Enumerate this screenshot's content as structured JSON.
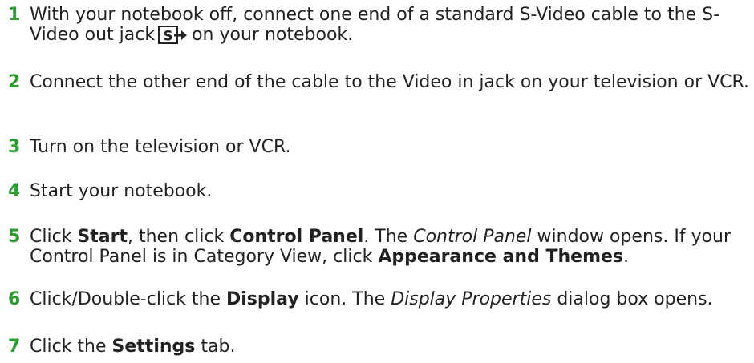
{
  "accent_color": "#2e9c33",
  "steps": [
    {
      "number": "1",
      "text_a": "With your notebook off, connect one end of a standard S-Video cable to the S-Video out jack",
      "icon": "s-video-out-icon",
      "text_b": "on your notebook."
    },
    {
      "number": "2",
      "text": "Connect the other end of the cable to the Video in jack on your television or VCR."
    },
    {
      "number": "3",
      "text": "Turn on the television or VCR."
    },
    {
      "number": "4",
      "text": "Start your notebook."
    },
    {
      "number": "5",
      "t1": "Click ",
      "b1": "Start",
      "t2": ", then click ",
      "b2": "Control Panel",
      "t3": ". The ",
      "i1": "Control Panel",
      "t4": " window opens. If your Control Panel is in Category View, click ",
      "b3": "Appearance and Themes",
      "t5": "."
    },
    {
      "number": "6",
      "t1": "Click/Double-click the ",
      "b1": "Display",
      "t2": " icon. The ",
      "i1": "Display Properties",
      "t3": " dialog box opens."
    },
    {
      "number": "7",
      "t1": "Click the ",
      "b1": "Settings",
      "t2": " tab."
    }
  ]
}
